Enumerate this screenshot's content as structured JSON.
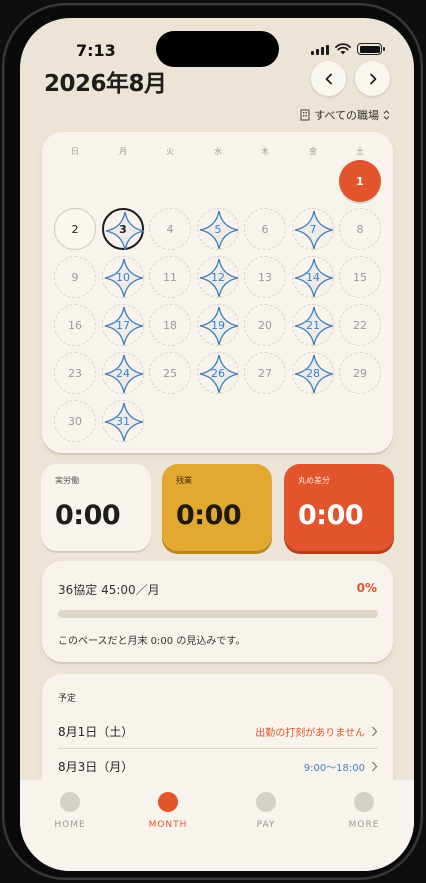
{
  "status": {
    "time": "7:13"
  },
  "header": {
    "month_title": "2026年8月",
    "workplace_label": "すべての職場"
  },
  "calendar": {
    "weekdays": [
      "日",
      "月",
      "火",
      "水",
      "木",
      "金",
      "土"
    ],
    "days": [
      {
        "n": "1",
        "style": "red"
      },
      {
        "n": "2",
        "style": "plain"
      },
      {
        "n": "3",
        "style": "selected-star"
      },
      {
        "n": "4",
        "style": "empty"
      },
      {
        "n": "5",
        "style": "star"
      },
      {
        "n": "6",
        "style": "empty"
      },
      {
        "n": "7",
        "style": "star"
      },
      {
        "n": "8",
        "style": "empty"
      },
      {
        "n": "9",
        "style": "empty"
      },
      {
        "n": "10",
        "style": "star"
      },
      {
        "n": "11",
        "style": "empty"
      },
      {
        "n": "12",
        "style": "star"
      },
      {
        "n": "13",
        "style": "empty"
      },
      {
        "n": "14",
        "style": "star"
      },
      {
        "n": "15",
        "style": "empty"
      },
      {
        "n": "16",
        "style": "empty"
      },
      {
        "n": "17",
        "style": "star"
      },
      {
        "n": "18",
        "style": "empty"
      },
      {
        "n": "19",
        "style": "star"
      },
      {
        "n": "20",
        "style": "empty"
      },
      {
        "n": "21",
        "style": "star"
      },
      {
        "n": "22",
        "style": "empty"
      },
      {
        "n": "23",
        "style": "empty"
      },
      {
        "n": "24",
        "style": "star"
      },
      {
        "n": "25",
        "style": "empty"
      },
      {
        "n": "26",
        "style": "star"
      },
      {
        "n": "27",
        "style": "empty"
      },
      {
        "n": "28",
        "style": "star"
      },
      {
        "n": "29",
        "style": "empty"
      },
      {
        "n": "30",
        "style": "empty"
      },
      {
        "n": "31",
        "style": "star"
      }
    ]
  },
  "metrics": {
    "actual": {
      "label": "実労働",
      "value": "0:00"
    },
    "overtime": {
      "label": "残業",
      "value": "0:00"
    },
    "rounding": {
      "label": "丸め差分",
      "value": "0:00"
    }
  },
  "agreement": {
    "title": "36協定 45:00／月",
    "percent": "0%",
    "progress": 0,
    "note": "このペースだと月末 0:00 の見込みです。"
  },
  "schedule": {
    "heading": "予定",
    "rows": [
      {
        "date": "8月1日（土）",
        "status": "出勤の打刻がありません",
        "status_color": "#e2552c"
      },
      {
        "date": "8月3日（月）",
        "status": "9:00～18:00",
        "status_color": "#3f7fc0"
      }
    ]
  },
  "tabs": [
    {
      "label": "HOME",
      "active": false
    },
    {
      "label": "MONTH",
      "active": true
    },
    {
      "label": "PAY",
      "active": false
    },
    {
      "label": "MORE",
      "active": false
    }
  ],
  "colors": {
    "accent": "#e2552c",
    "amber": "#e3a832",
    "star_blue": "#3f7fc0",
    "background": "#ece4d6"
  },
  "icons": {
    "prev": "chevron-left-icon",
    "next": "chevron-right-icon",
    "workplace": "building-icon",
    "workplace_toggle": "chevron-up-down-icon",
    "row_chevron": "chevron-right-icon"
  }
}
